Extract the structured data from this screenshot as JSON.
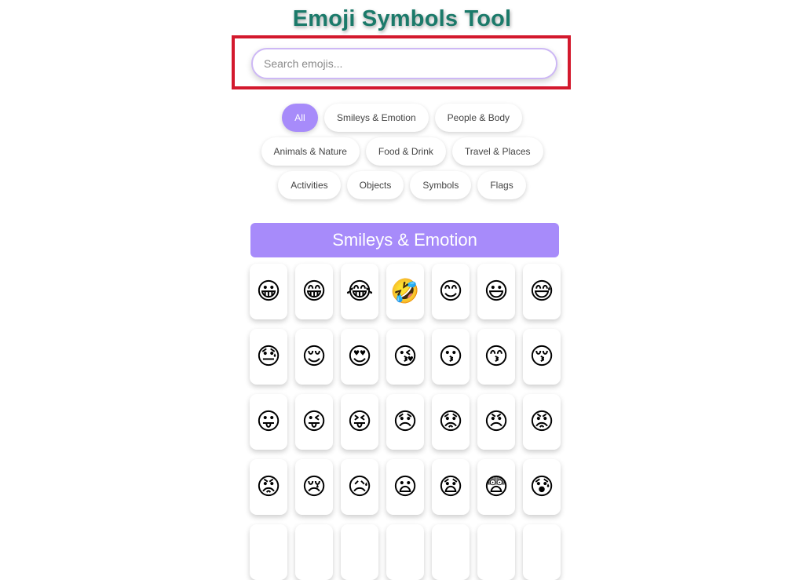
{
  "app": {
    "title": "Emoji Symbols Tool"
  },
  "search": {
    "placeholder": "Search emojis...",
    "value": ""
  },
  "categories": [
    {
      "label": "All",
      "active": true
    },
    {
      "label": "Smileys & Emotion",
      "active": false
    },
    {
      "label": "People & Body",
      "active": false
    },
    {
      "label": "Animals & Nature",
      "active": false
    },
    {
      "label": "Food & Drink",
      "active": false
    },
    {
      "label": "Travel & Places",
      "active": false
    },
    {
      "label": "Activities",
      "active": false
    },
    {
      "label": "Objects",
      "active": false
    },
    {
      "label": "Symbols",
      "active": false
    },
    {
      "label": "Flags",
      "active": false
    }
  ],
  "section": {
    "title": "Smileys & Emotion",
    "emojis": [
      "😀",
      "😁",
      "😂",
      "🤣",
      "😊",
      "😃",
      "😅",
      "😓",
      "😌",
      "😍",
      "😘",
      "😗",
      "😙",
      "😚",
      "😛",
      "😜",
      "😝",
      "😞",
      "😟",
      "😠",
      "😡",
      "😡",
      "😢",
      "😥",
      "😦",
      "😧",
      "😨",
      "😰"
    ]
  },
  "colors": {
    "accent": "#a78bfa",
    "title": "#1b7a6a",
    "highlight_box": "#d3192d",
    "search_border": "#cdb8f5"
  }
}
